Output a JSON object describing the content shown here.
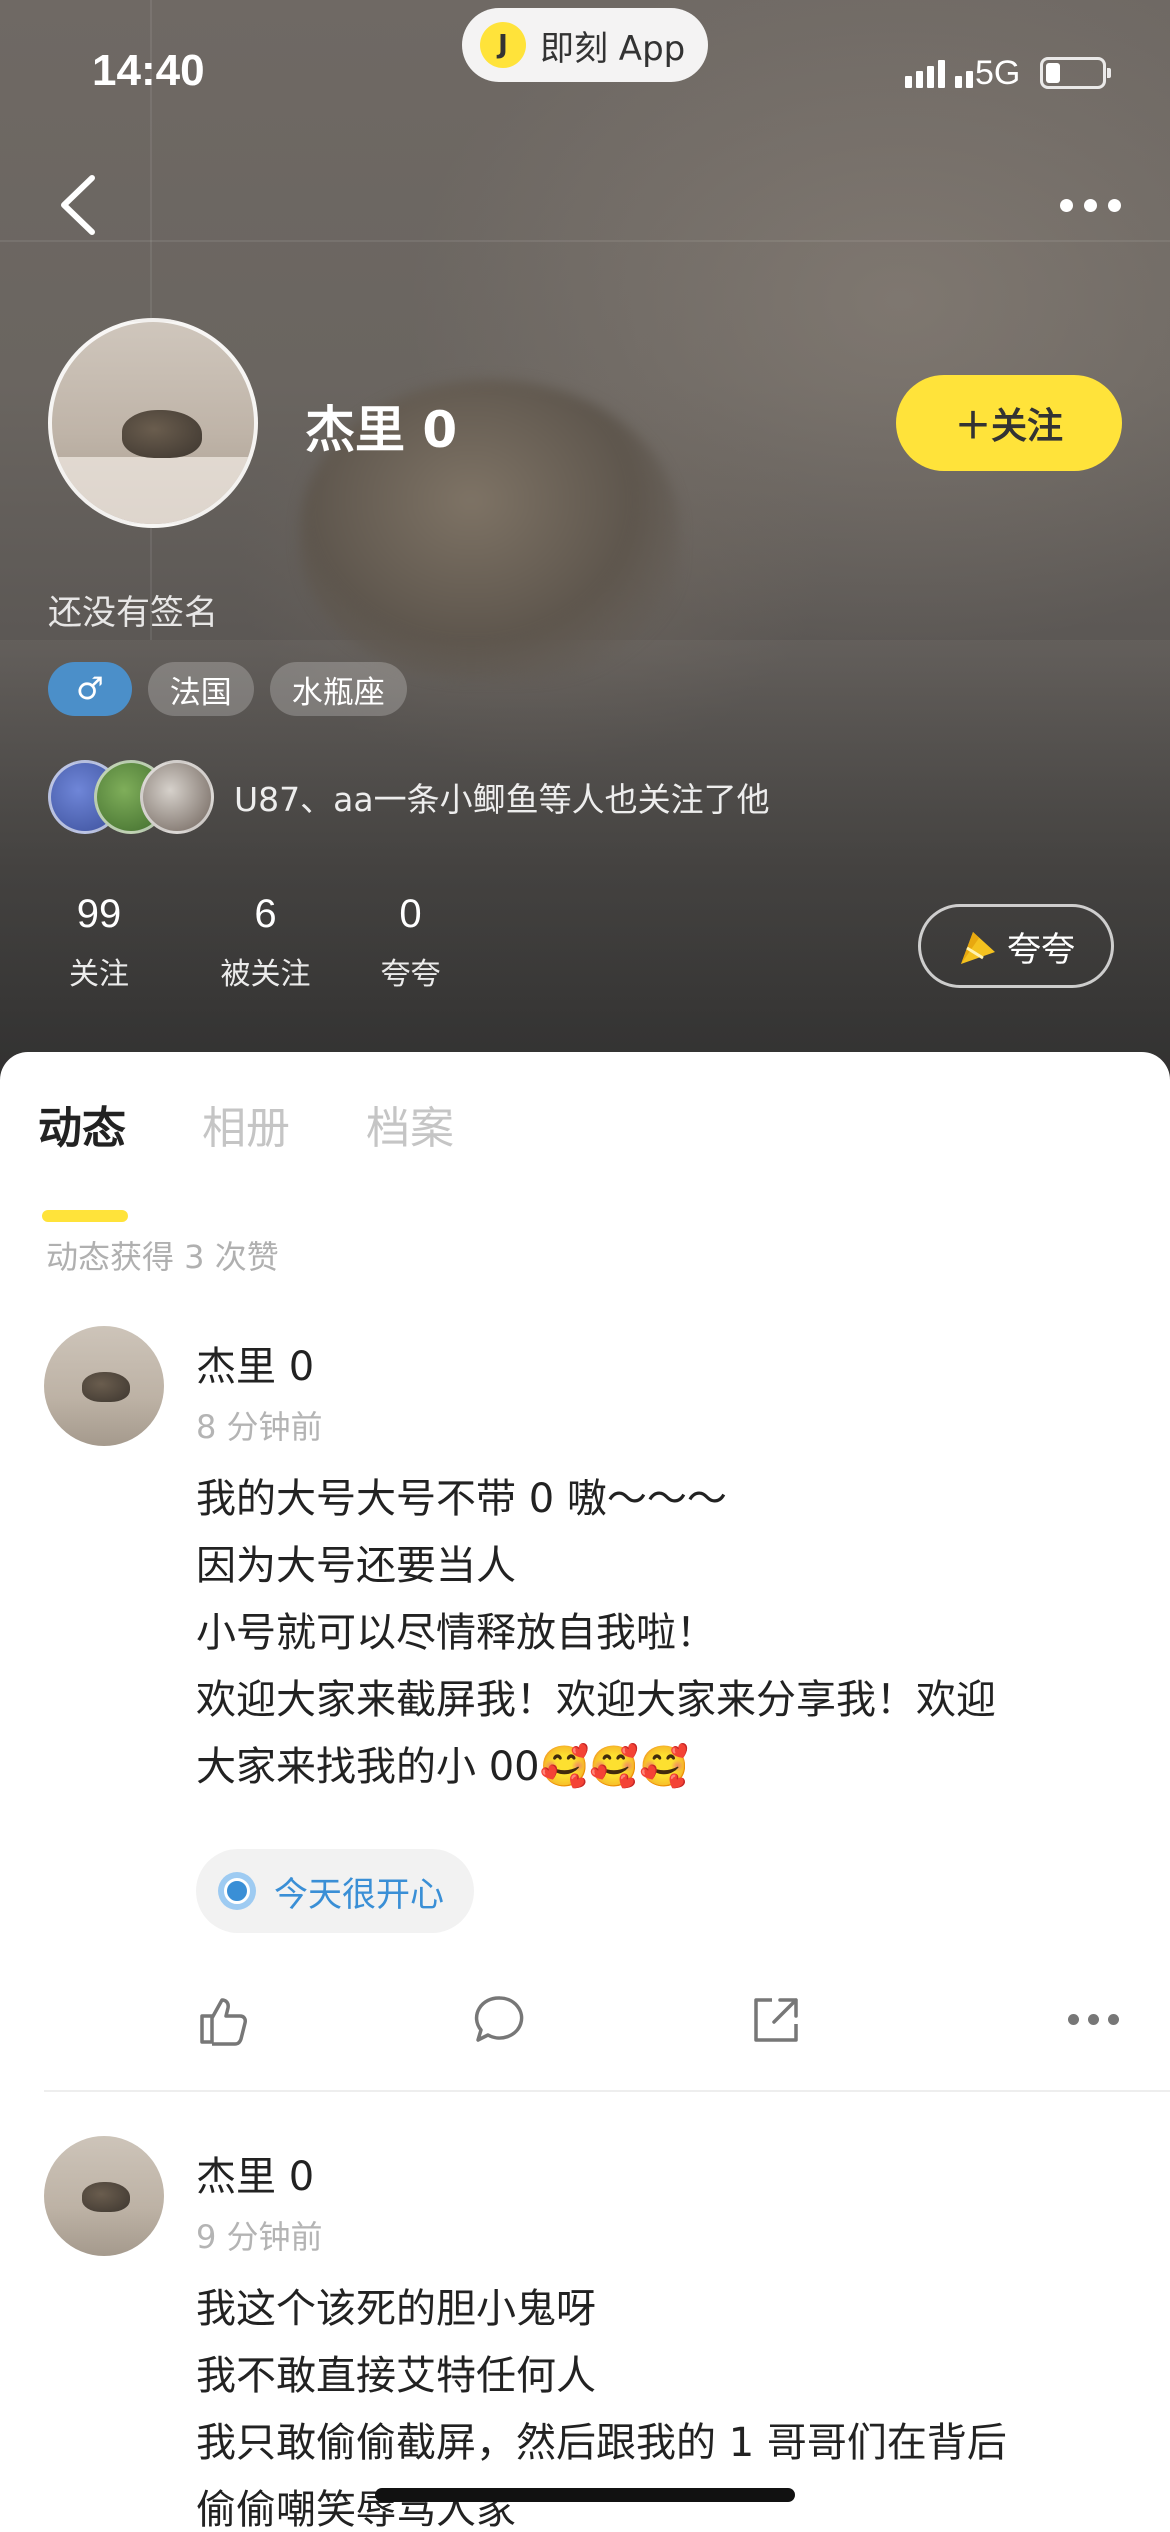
{
  "status_bar": {
    "time": "14:40",
    "app_pill_label": "即刻 App",
    "app_logo_glyph": "J",
    "network": "5G"
  },
  "header": {
    "back_icon": "chevron-left-icon",
    "more_icon": "more-horizontal-icon"
  },
  "profile": {
    "name": "杰里 0",
    "follow_label": "＋关注",
    "signature": "还没有签名",
    "tags": [
      {
        "label": "♂",
        "kind": "gender"
      },
      {
        "label": "法国",
        "kind": "location"
      },
      {
        "label": "水瓶座",
        "kind": "zodiac"
      }
    ],
    "mutuals_text": "U87、aa一条小鲫鱼等人也关注了他",
    "stats": [
      {
        "value": "99",
        "label": "关注"
      },
      {
        "value": "6",
        "label": "被关注"
      },
      {
        "value": "0",
        "label": "夸夸"
      }
    ],
    "praise_label": "夸夸"
  },
  "tabs": [
    {
      "label": "动态",
      "active": true
    },
    {
      "label": "相册",
      "active": false
    },
    {
      "label": "档案",
      "active": false
    }
  ],
  "likes_info": "动态获得 3 次赞",
  "posts": [
    {
      "author": "杰里 0",
      "time": "8 分钟前",
      "lines": [
        "我的大号大号不带 0 嗷～～～",
        "因为大号还要当人",
        "小号就可以尽情释放自我啦！",
        "欢迎大家来截屏我！欢迎大家来分享我！欢迎",
        "大家来找我的小 00🥰🥰🥰"
      ],
      "topic": "今天很开心"
    },
    {
      "author": "杰里 0",
      "time": "9 分钟前",
      "lines": [
        "我这个该死的胆小鬼呀",
        "我不敢直接艾特任何人",
        "我只敢偷偷截屏，然后跟我的 1 哥哥们在背后",
        "偷偷嘲笑辱骂人家"
      ]
    }
  ],
  "colors": {
    "accent_yellow": "#ffe33a",
    "topic_blue": "#3a8fd6",
    "gender_tag_blue": "#4b8fc9"
  }
}
